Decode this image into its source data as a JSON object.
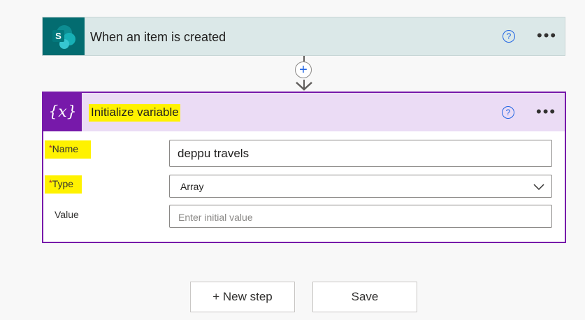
{
  "trigger": {
    "title": "When an item is created",
    "icon": "sharepoint-icon",
    "icon_letter": "S",
    "accent": "#036c70",
    "help": "?",
    "more": "•••"
  },
  "connector": {
    "add_symbol": "+"
  },
  "action": {
    "title": "Initialize variable",
    "icon": "variable-icon",
    "icon_glyph": "{x}",
    "accent": "#7719aa",
    "help": "?",
    "more": "•••",
    "fields": {
      "name": {
        "required_mark": "*",
        "label": "Name",
        "value": "deppu travels"
      },
      "type": {
        "required_mark": "*",
        "label": "Type",
        "value": "Array"
      },
      "value": {
        "label": "Value",
        "placeholder": "Enter initial value"
      }
    }
  },
  "buttons": {
    "new_step": "+ New step",
    "save": "Save"
  }
}
